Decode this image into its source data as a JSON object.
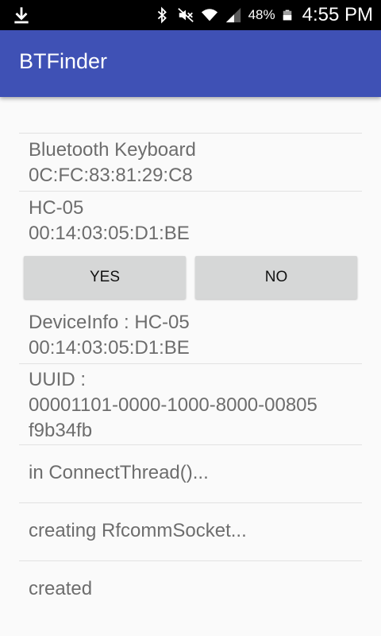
{
  "status_bar": {
    "battery_percent": "48%",
    "time": "4:55 PM",
    "icons": [
      "download-icon",
      "bluetooth-icon",
      "mute-icon",
      "wifi-icon",
      "signal-icon",
      "battery-icon"
    ]
  },
  "app_bar": {
    "title": "BTFinder",
    "color": "#3f51b5"
  },
  "paired_devices": [
    {
      "name": "Bluetooth  Keyboard",
      "address": "0C:FC:83:81:29:C8"
    },
    {
      "name": "HC-05",
      "address": "00:14:03:05:D1:BE"
    }
  ],
  "buttons": {
    "yes_label": "YES",
    "no_label": "NO"
  },
  "log": {
    "device_info_line1": "DeviceInfo : HC-05",
    "device_info_line2": "00:14:03:05:D1:BE",
    "uuid_line1": "UUID :",
    "uuid_line2": "00001101-0000-1000-8000-00805",
    "uuid_line3": "f9b34fb",
    "entries": [
      "in ConnectThread()...",
      "creating RfcommSocket...",
      "created"
    ]
  }
}
